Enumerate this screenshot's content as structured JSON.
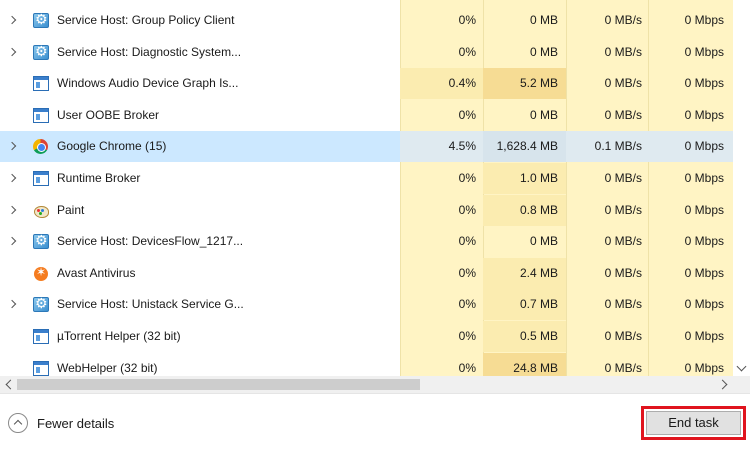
{
  "processes": [
    {
      "name": "Service Host: Group Policy Client",
      "icon": "gear-icon",
      "expandable": true,
      "cpu": "0%",
      "memory": "0 MB",
      "disk": "0 MB/s",
      "network": "0 Mbps"
    },
    {
      "name": "Service Host: Diagnostic System...",
      "icon": "gear-icon",
      "expandable": true,
      "cpu": "0%",
      "memory": "0 MB",
      "disk": "0 MB/s",
      "network": "0 Mbps"
    },
    {
      "name": "Windows Audio Device Graph Is...",
      "icon": "window-app-icon",
      "expandable": false,
      "cpu": "0.4%",
      "memory": "5.2 MB",
      "disk": "0 MB/s",
      "network": "0 Mbps"
    },
    {
      "name": "User OOBE Broker",
      "icon": "window-app-icon",
      "expandable": false,
      "cpu": "0%",
      "memory": "0 MB",
      "disk": "0 MB/s",
      "network": "0 Mbps"
    },
    {
      "name": "Google Chrome (15)",
      "icon": "chrome-icon",
      "expandable": true,
      "selected": true,
      "cpu": "4.5%",
      "memory": "1,628.4 MB",
      "disk": "0.1 MB/s",
      "network": "0 Mbps"
    },
    {
      "name": "Runtime Broker",
      "icon": "window-app-icon",
      "expandable": true,
      "cpu": "0%",
      "memory": "1.0 MB",
      "disk": "0 MB/s",
      "network": "0 Mbps"
    },
    {
      "name": "Paint",
      "icon": "paint-icon",
      "expandable": true,
      "cpu": "0%",
      "memory": "0.8 MB",
      "disk": "0 MB/s",
      "network": "0 Mbps"
    },
    {
      "name": "Service Host: DevicesFlow_1217...",
      "icon": "gear-icon",
      "expandable": true,
      "cpu": "0%",
      "memory": "0 MB",
      "disk": "0 MB/s",
      "network": "0 Mbps"
    },
    {
      "name": "Avast Antivirus",
      "icon": "avast-icon",
      "expandable": false,
      "cpu": "0%",
      "memory": "2.4 MB",
      "disk": "0 MB/s",
      "network": "0 Mbps"
    },
    {
      "name": "Service Host: Unistack Service G...",
      "icon": "gear-icon",
      "expandable": true,
      "cpu": "0%",
      "memory": "0.7 MB",
      "disk": "0 MB/s",
      "network": "0 Mbps"
    },
    {
      "name": "µTorrent Helper (32 bit)",
      "icon": "window-app-icon",
      "expandable": false,
      "cpu": "0%",
      "memory": "0.5 MB",
      "disk": "0 MB/s",
      "network": "0 Mbps"
    },
    {
      "name": "WebHelper (32 bit)",
      "icon": "window-app-icon",
      "expandable": false,
      "cpu": "0%",
      "memory": "24.8 MB",
      "disk": "0 MB/s",
      "network": "0 Mbps"
    }
  ],
  "footer": {
    "fewer_details_label": "Fewer details",
    "end_task_label": "End task"
  },
  "colors": {
    "column_tint": "#fff4c4",
    "tint_light": "#fff9e0",
    "tint_medium": "#fbecb0",
    "tint_strong": "#f6dc94",
    "selected_row": "#cce8ff",
    "highlight_border": "#e0141e"
  }
}
